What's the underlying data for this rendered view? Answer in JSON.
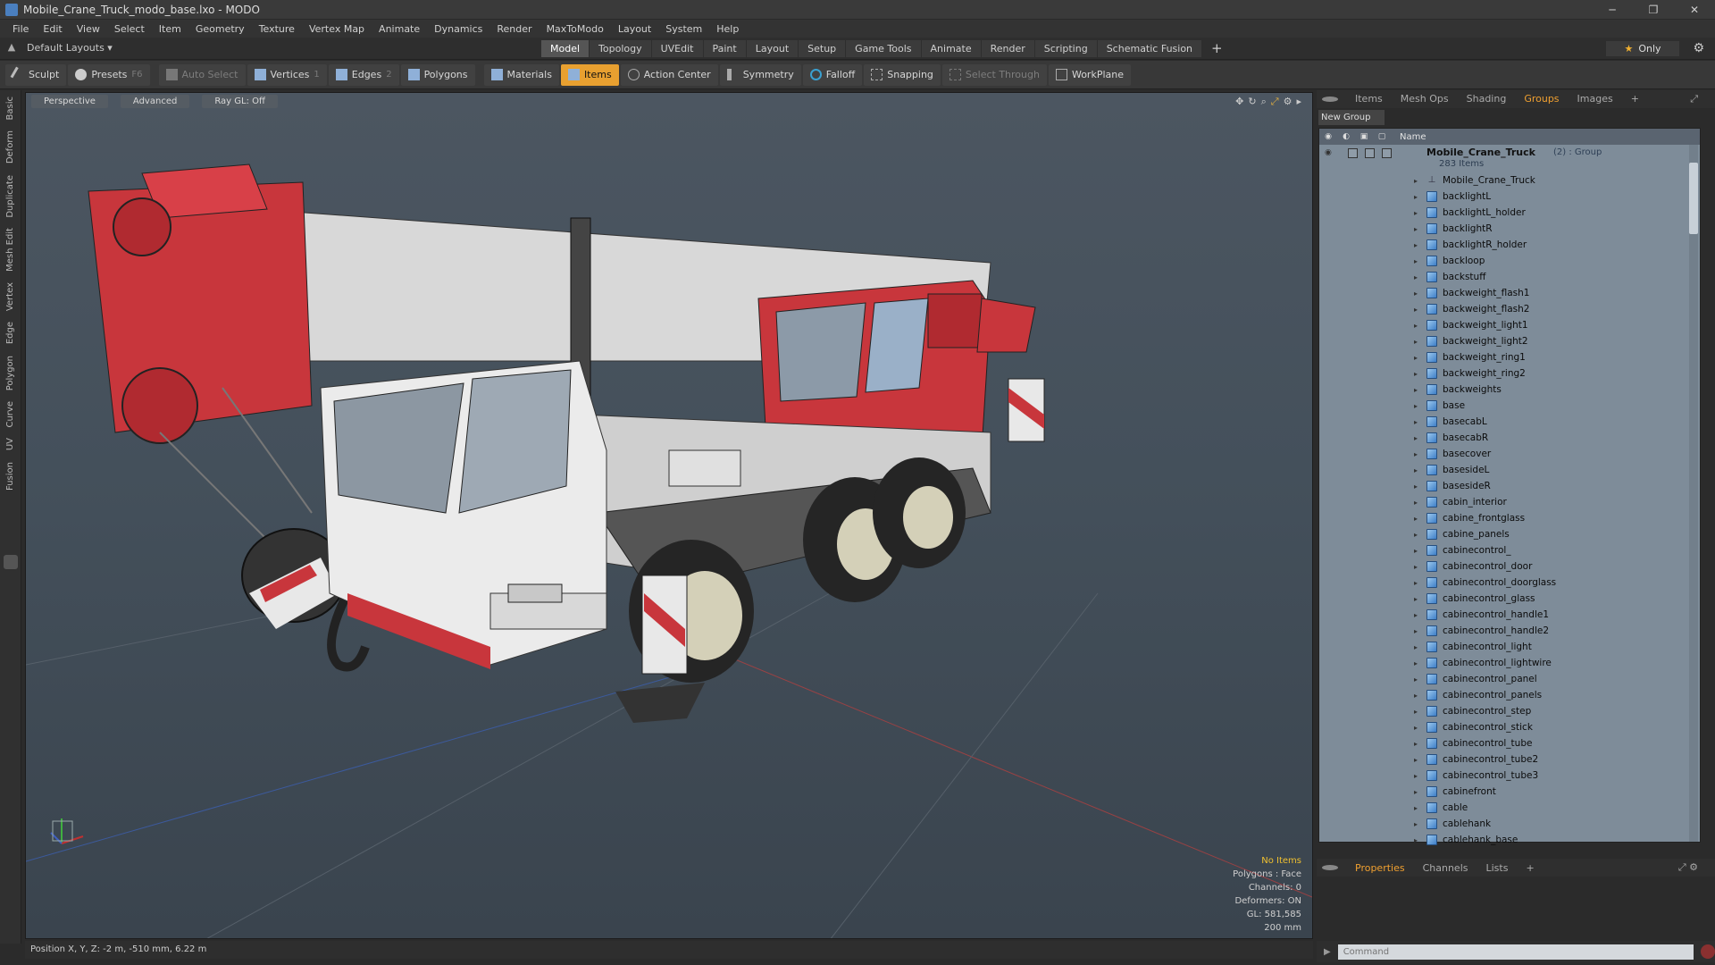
{
  "window": {
    "title": "Mobile_Crane_Truck_modo_base.lxo - MODO",
    "minimize": "─",
    "maximize": "❐",
    "close": "✕"
  },
  "menu": [
    "File",
    "Edit",
    "View",
    "Select",
    "Item",
    "Geometry",
    "Texture",
    "Vertex Map",
    "Animate",
    "Dynamics",
    "Render",
    "MaxToModo",
    "Layout",
    "System",
    "Help"
  ],
  "layout": {
    "name": "Default Layouts ▾",
    "only_label": "Only"
  },
  "layout_tabs": [
    "Model",
    "Topology",
    "UVEdit",
    "Paint",
    "Layout",
    "Setup",
    "Game Tools",
    "Animate",
    "Render",
    "Scripting",
    "Schematic Fusion"
  ],
  "toolbar": {
    "sculpt": "Sculpt",
    "presets": "Presets",
    "presets_key": "F6",
    "auto_select": "Auto Select",
    "vertices": "Vertices",
    "vertices_key": "1",
    "edges": "Edges",
    "edges_key": "2",
    "polygons": "Polygons",
    "materials": "Materials",
    "items": "Items",
    "action_center": "Action Center",
    "symmetry": "Symmetry",
    "falloff": "Falloff",
    "snapping": "Snapping",
    "select_through": "Select Through",
    "workplane": "WorkPlane"
  },
  "left_tabs": [
    "Basic",
    "Deform",
    "Duplicate",
    "Mesh Edit",
    "Vertex",
    "Edge",
    "Polygon",
    "Curve",
    "UV",
    "Fusion"
  ],
  "viewport": {
    "view": "Perspective",
    "shading": "Advanced",
    "raygl": "Ray GL: Off",
    "info": {
      "items": "No Items",
      "polygons": "Polygons : Face",
      "channels": "Channels: 0",
      "deformers": "Deformers: ON",
      "gl": "GL: 581,585",
      "scale": "200 mm"
    },
    "axis_y": "Y",
    "axis_x": "X",
    "axis_z": "Z"
  },
  "status": {
    "position": "Position X, Y, Z:  -2 m, -510 mm, 6.22 m"
  },
  "right_panel": {
    "tabs": [
      "Items",
      "Mesh Ops",
      "Shading",
      "Groups",
      "Images"
    ],
    "active_tab": "Groups",
    "new_group": "New Group",
    "column_name": "Name",
    "group": {
      "name": "Mobile_Crane_Truck",
      "tag": "(2) : Group",
      "count": "283 Items"
    },
    "items": [
      "Mobile_Crane_Truck",
      "backlightL",
      "backlightL_holder",
      "backlightR",
      "backlightR_holder",
      "backloop",
      "backstuff",
      "backweight_flash1",
      "backweight_flash2",
      "backweight_light1",
      "backweight_light2",
      "backweight_ring1",
      "backweight_ring2",
      "backweights",
      "base",
      "basecabL",
      "basecabR",
      "basecover",
      "basesideL",
      "basesideR",
      "cabin_interior",
      "cabine_frontglass",
      "cabine_panels",
      "cabinecontrol_",
      "cabinecontrol_door",
      "cabinecontrol_doorglass",
      "cabinecontrol_glass",
      "cabinecontrol_handle1",
      "cabinecontrol_handle2",
      "cabinecontrol_light",
      "cabinecontrol_lightwire",
      "cabinecontrol_panel",
      "cabinecontrol_panels",
      "cabinecontrol_step",
      "cabinecontrol_stick",
      "cabinecontrol_tube",
      "cabinecontrol_tube2",
      "cabinecontrol_tube3",
      "cabinefront",
      "cable",
      "cablehank",
      "cablehank_base"
    ],
    "bottom_tabs": [
      "Properties",
      "Channels",
      "Lists"
    ],
    "command_placeholder": "Command"
  }
}
